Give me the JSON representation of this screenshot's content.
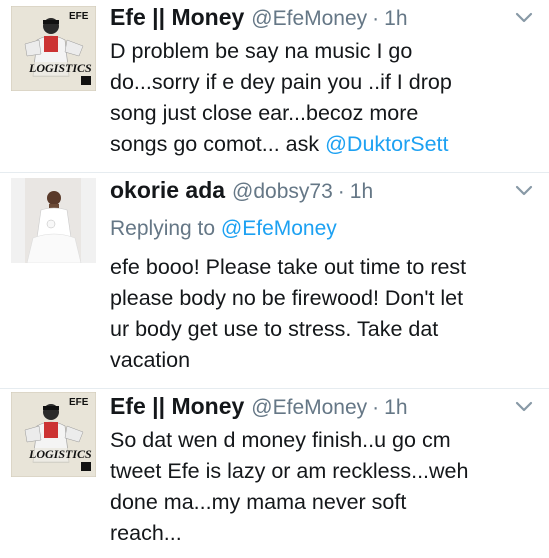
{
  "tweets": [
    {
      "name": "Efe || Money",
      "handle": "@EfeMoney",
      "separator": "·",
      "time": "1h",
      "avatar_icon": "album-cover-logistics",
      "avatar_text": "EFE",
      "avatar_title": "LOGISTICS",
      "replying_to": null,
      "lines": [
        "D problem be say na music I go",
        "do...sorry if e dey pain you ..if I drop",
        "song just close ear...becoz more",
        "songs go comot... ask "
      ],
      "trailing_mention": "@DuktorSett"
    },
    {
      "name": "okorie ada",
      "handle": "@dobsy73",
      "separator": "·",
      "time": "1h",
      "avatar_icon": "bride-photo",
      "replying_to_label": "Replying to ",
      "replying_to_handle": "@EfeMoney",
      "lines": [
        "efe booo! Please take out time to rest",
        "please body no be firewood! Don't let",
        "ur body get use to stress. Take dat",
        "vacation"
      ]
    },
    {
      "name": "Efe || Money",
      "handle": "@EfeMoney",
      "separator": "·",
      "time": "1h",
      "avatar_icon": "album-cover-logistics",
      "avatar_text": "EFE",
      "avatar_title": "LOGISTICS",
      "lines": [
        "So dat wen d money finish..u go cm",
        "tweet Efe is lazy or am reckless...weh",
        "done ma...my mama never soft",
        "reach..."
      ]
    }
  ],
  "colors": {
    "text": "#14171a",
    "secondary": "#657786",
    "link": "#1da1f2",
    "divider": "#e6ecf0"
  }
}
